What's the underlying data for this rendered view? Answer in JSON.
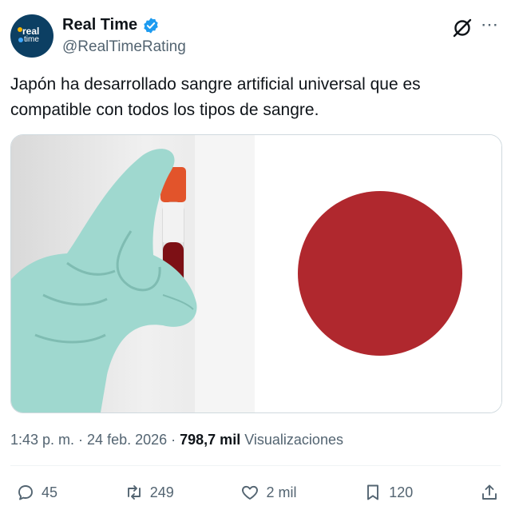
{
  "author": {
    "avatar_line1": "real",
    "avatar_line2": "time",
    "name": "Real Time",
    "handle": "@RealTimeRating",
    "verified": true
  },
  "tweet": {
    "text": "Japón ha desarrollado sangre artificial universal que es compatible con todos los tipos de sangre."
  },
  "meta": {
    "time": "1:43 p. m.",
    "sep1": " · ",
    "date": "24 feb. 2026",
    "sep2": " · ",
    "views_count": "798,7 mil",
    "views_label": "Visualizaciones"
  },
  "actions": {
    "replies": "45",
    "retweets": "249",
    "likes": "2 mil",
    "bookmarks": "120"
  },
  "icons": {
    "verified": "verified-badge-icon",
    "grok": "grok-icon",
    "more": "more-icon",
    "reply": "reply-icon",
    "retweet": "retweet-icon",
    "like": "heart-icon",
    "bookmark": "bookmark-icon",
    "share": "share-icon"
  },
  "colors": {
    "verified": "#1d9bf0",
    "japan_red": "#b0282e",
    "glove": "#9fd8cf",
    "text": "#0f1419",
    "muted": "#536471"
  }
}
